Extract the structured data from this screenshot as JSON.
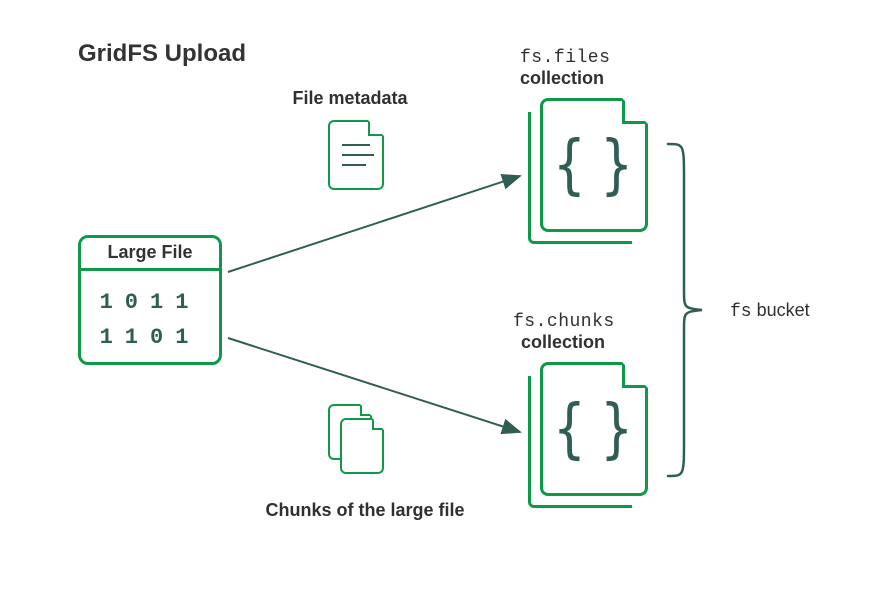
{
  "title": "GridFS Upload",
  "large_file": {
    "header": "Large File",
    "bits_line1": "1011",
    "bits_line2": "1101"
  },
  "metadata_label": "File metadata",
  "chunks_label": "Chunks of the large file",
  "files_collection": {
    "code": "fs.files",
    "label": "collection"
  },
  "chunks_collection": {
    "code": "fs.chunks",
    "label": "collection"
  },
  "bucket": {
    "code": "fs",
    "label": "bucket"
  },
  "colors": {
    "green": "#0d9947",
    "dark_teal": "#2f5e55",
    "text": "#303030"
  },
  "icons": {
    "braces": "{}"
  }
}
